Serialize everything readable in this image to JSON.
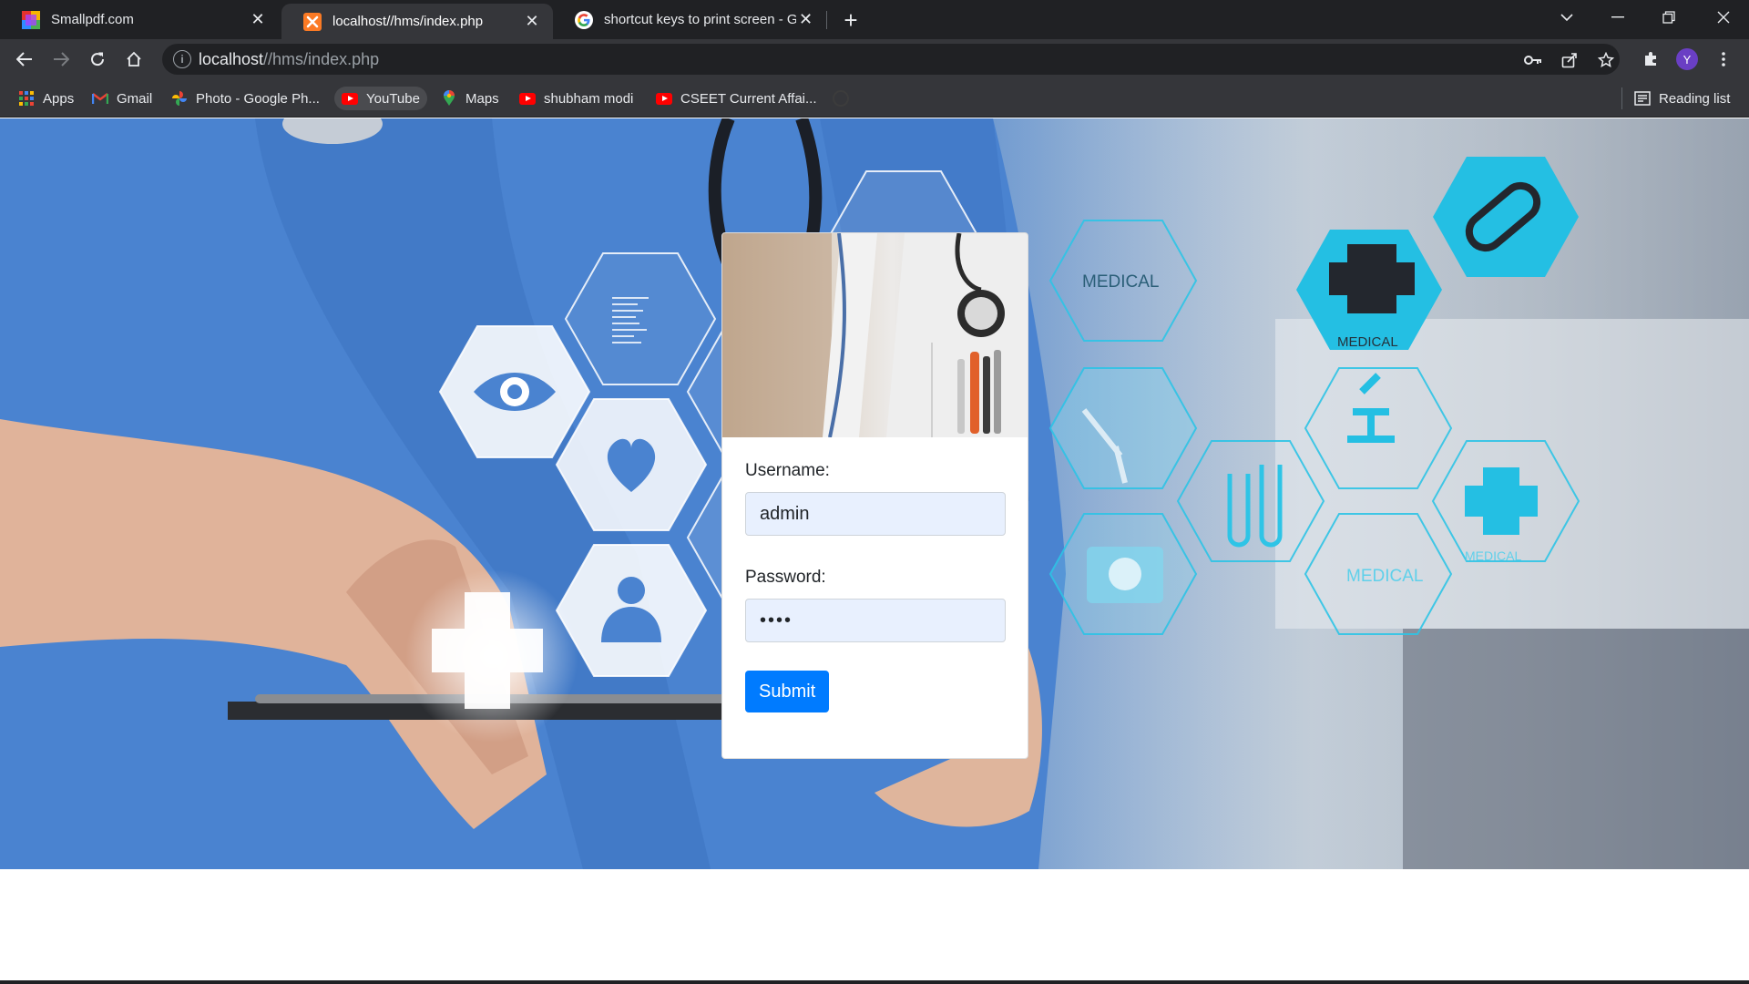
{
  "browser": {
    "tabs": [
      {
        "title": "Smallpdf.com",
        "active": false,
        "favicon": "smallpdf-icon"
      },
      {
        "title": "localhost//hms/index.php",
        "active": true,
        "favicon": "xampp-icon"
      },
      {
        "title": "shortcut keys to print screen - Go",
        "active": false,
        "favicon": "google-icon"
      }
    ],
    "url_host": "localhost",
    "url_path": "//hms/index.php",
    "profile_initial": "Y",
    "bookmarks": [
      {
        "label": "Apps",
        "icon": "apps-grid-icon"
      },
      {
        "label": "Gmail",
        "icon": "gmail-icon"
      },
      {
        "label": "Photo - Google Ph...",
        "icon": "google-photos-icon"
      },
      {
        "label": "YouTube",
        "icon": "youtube-icon"
      },
      {
        "label": "Maps",
        "icon": "maps-pin-icon"
      },
      {
        "label": "shubham modi",
        "icon": "youtube-icon"
      },
      {
        "label": "CSEET Current Affai...",
        "icon": "youtube-icon"
      }
    ],
    "reading_list": "Reading list"
  },
  "hero": {
    "hex_labels": [
      "MEDICAL",
      "MEDICAL",
      "MEDICAL",
      "MEDICAL"
    ]
  },
  "login": {
    "username_label": "Username:",
    "username_value": "admin",
    "password_label": "Password:",
    "password_value": "••••",
    "submit_label": "Submit"
  },
  "colors": {
    "primary_button": "#007bff",
    "autofill_background": "#e8f0fe",
    "chrome_dark": "#202124",
    "chrome_toolbar": "#35363a",
    "scrub_blue": "#4a83d0",
    "hologram_cyan": "#2ec4e6"
  }
}
